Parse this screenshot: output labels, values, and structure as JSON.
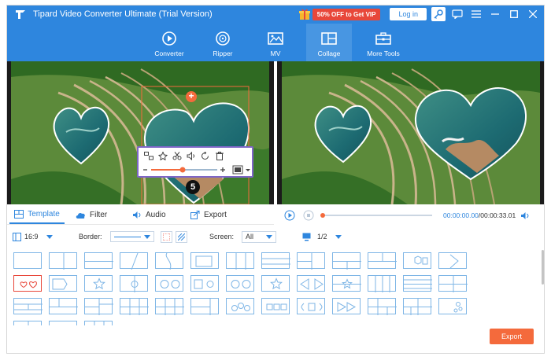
{
  "window": {
    "title": "Tipard Video Converter Ultimate (Trial Version)",
    "promo_label": "50% OFF to Get VIP",
    "login_label": "Log in"
  },
  "nav": {
    "items": [
      {
        "label": "Converter",
        "icon": "converter-icon"
      },
      {
        "label": "Ripper",
        "icon": "ripper-icon"
      },
      {
        "label": "MV",
        "icon": "mv-icon"
      },
      {
        "label": "Collage",
        "icon": "collage-icon",
        "active": true
      },
      {
        "label": "More Tools",
        "icon": "toolbox-icon"
      }
    ]
  },
  "preview": {
    "step_number": "5"
  },
  "tabs": [
    {
      "label": "Template",
      "icon": "template-icon",
      "active": true
    },
    {
      "label": "Filter",
      "icon": "cloud-icon"
    },
    {
      "label": "Audio",
      "icon": "speaker-icon"
    },
    {
      "label": "Export",
      "icon": "export-icon"
    }
  ],
  "playback": {
    "current_time": "00:00:00.00",
    "total_time": "/00:00:33.01",
    "progress": 0.0
  },
  "options": {
    "aspect": "16:9",
    "border_label": "Border:",
    "screen_label": "Screen:",
    "screen_value": "All",
    "page": "1/2"
  },
  "export_label": "Export",
  "colors": {
    "accent": "#2e86de",
    "orange": "#f46a3c",
    "promo_red": "#e8473a",
    "toolbar_outline": "#7e66c8"
  }
}
